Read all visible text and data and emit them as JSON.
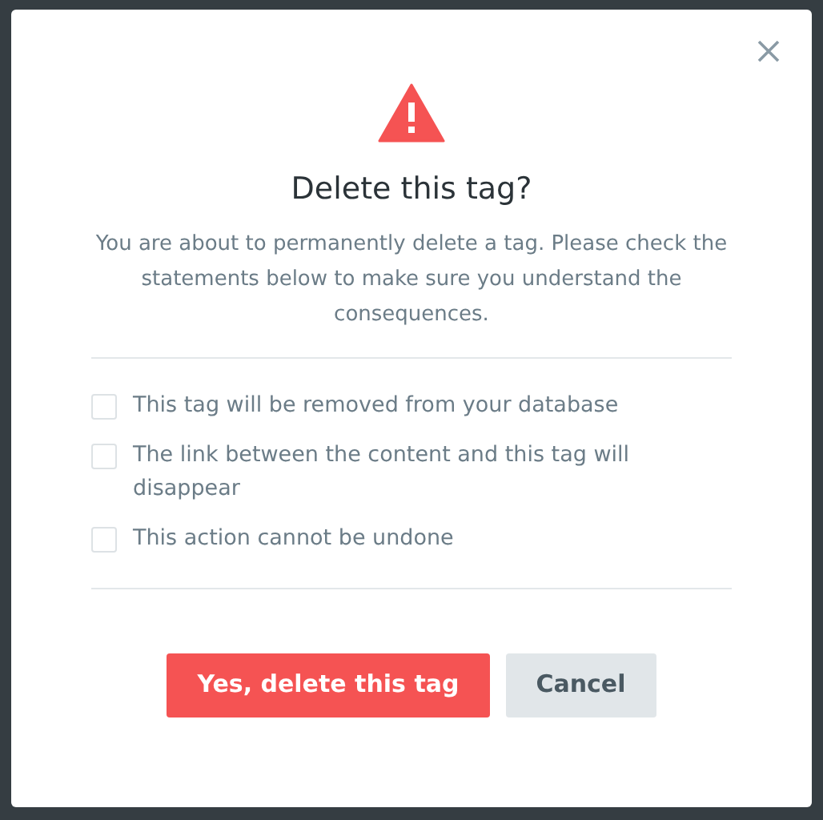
{
  "dialog": {
    "title": "Delete this tag?",
    "message": "You are about to permanently delete a tag. Please check the statements below to make sure you understand the consequences.",
    "statements": [
      {
        "label": "This tag will be removed from your database",
        "checked": false
      },
      {
        "label": "The link between the content and this tag will disappear",
        "checked": false
      },
      {
        "label": "This action cannot be undone",
        "checked": false
      }
    ],
    "buttons": [
      {
        "label": "Yes, delete this tag",
        "kind": "danger"
      },
      {
        "label": "Cancel",
        "kind": "secondary"
      }
    ]
  }
}
